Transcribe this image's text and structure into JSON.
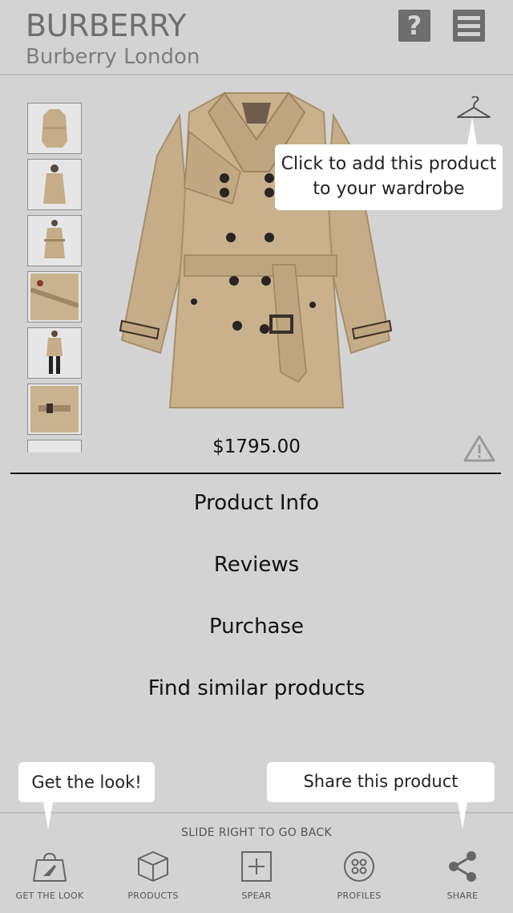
{
  "header": {
    "brand": "BURBERRY",
    "subtitle": "Burberry London",
    "help_icon": "question-icon",
    "menu_icon": "hamburger-menu-icon"
  },
  "thumbnails": [
    {
      "name": "thumb-coat-front"
    },
    {
      "name": "thumb-model-front"
    },
    {
      "name": "thumb-coat-belted"
    },
    {
      "name": "thumb-fabric-detail"
    },
    {
      "name": "thumb-model-full"
    },
    {
      "name": "thumb-cuff-detail"
    }
  ],
  "product": {
    "price": "$1795.00",
    "coat_color": "#c4ad88"
  },
  "tooltips": {
    "wardrobe_line1": "Click to add this product",
    "wardrobe_line2": "to your wardrobe",
    "get_look": "Get the look!",
    "share": "Share this product"
  },
  "menu": {
    "product_info": "Product Info",
    "reviews": "Reviews",
    "purchase": "Purchase",
    "similar": "Find similar products"
  },
  "bottom": {
    "slide_hint": "SLIDE RIGHT TO GO BACK",
    "nav": [
      {
        "label": "GET THE LOOK",
        "icon": "shopping-bag-heel-icon"
      },
      {
        "label": "PRODUCTS",
        "icon": "box-icon"
      },
      {
        "label": "SPEAR",
        "icon": "plus-square-icon"
      },
      {
        "label": "PROFILES",
        "icon": "circle-dots-icon"
      },
      {
        "label": "SHARE",
        "icon": "share-icon"
      }
    ]
  }
}
